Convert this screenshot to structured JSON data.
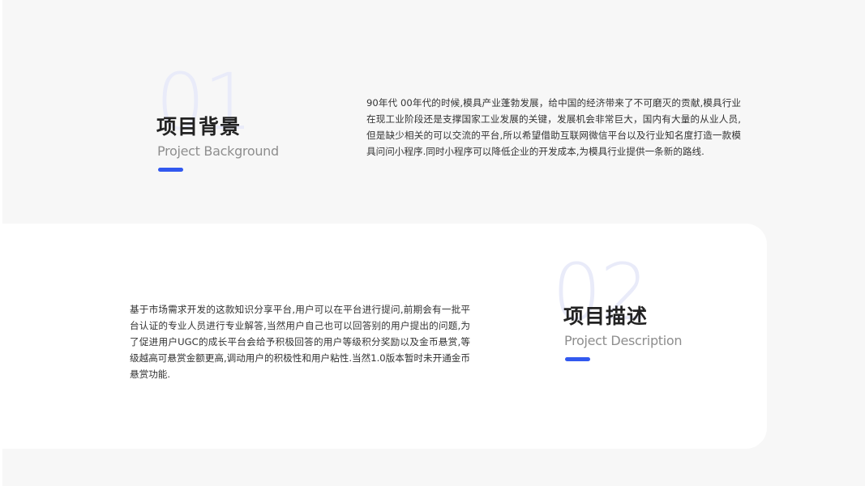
{
  "sections": [
    {
      "number": "01",
      "title": "项目背景",
      "subtitle": "Project Background",
      "body": "90年代 00年代的时候,模具产业蓬勃发展，给中国的经济带来了不可磨灭的贡献,模具行业在现工业阶段还是支撑国家工业发展的关键，发展机会非常巨大，国内有大量的从业人员,但是缺少相关的可以交流的平台,所以希望借助互联网微信平台以及行业知名度打造一款模具问问小程序.同时小程序可以降低企业的开发成本,为模具行业提供一条新的路线."
    },
    {
      "number": "02",
      "title": "项目描述",
      "subtitle": "Project Description",
      "body": "基于市场需求开发的这款知识分享平台,用户可以在平台进行提问,前期会有一批平台认证的专业人员进行专业解答,当然用户自己也可以回答别的用户提出的问题,为了促进用户UGC的成长平台会给予积极回答的用户等级积分奖励以及金币悬赏,等级越高可悬赏金额更高,调动用户的积极性和用户粘性.当然1.0版本暂时未开通金币悬赏功能."
    }
  ],
  "colors": {
    "accent": "#3259ef",
    "number_watermark": "#e9ebf9",
    "page_background": "#f7f7f7",
    "card_background": "#ffffff",
    "title_text": "#222222",
    "subtitle_text": "#8e8e8e",
    "body_text": "#333333"
  }
}
